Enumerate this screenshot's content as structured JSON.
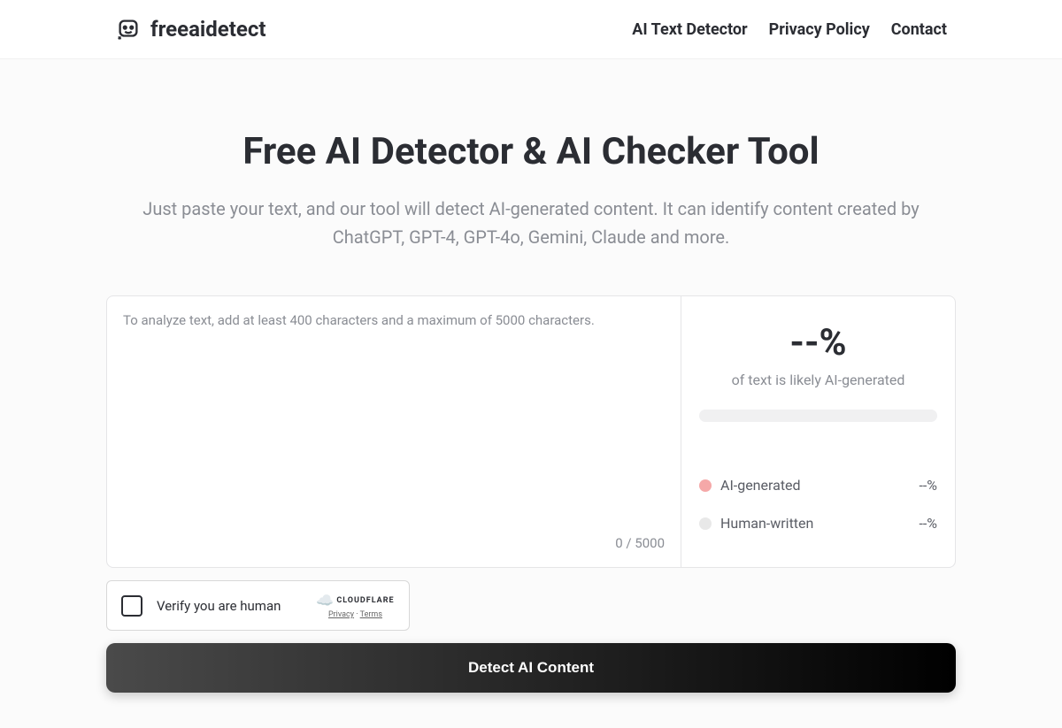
{
  "header": {
    "brand": "freeaidetect",
    "nav": {
      "detector": "AI Text Detector",
      "privacy": "Privacy Policy",
      "contact": "Contact"
    }
  },
  "hero": {
    "title": "Free AI Detector & AI Checker Tool",
    "subtitle": "Just paste your text, and our tool will detect AI-generated content. It can identify content created by ChatGPT, GPT-4, GPT-4o, Gemini, Claude and more."
  },
  "textarea": {
    "placeholder": "To analyze text, add at least 400 characters and a maximum of 5000 characters.",
    "counter": "0 / 5000"
  },
  "results": {
    "percent": "--%",
    "label": "of text is likely AI-generated",
    "ai_label": "AI-generated",
    "ai_value": "--%",
    "human_label": "Human-written",
    "human_value": "--%"
  },
  "captcha": {
    "text": "Verify you are human",
    "brand": "CLOUDFLARE",
    "privacy": "Privacy",
    "terms": "Terms"
  },
  "button": {
    "detect": "Detect AI Content"
  }
}
